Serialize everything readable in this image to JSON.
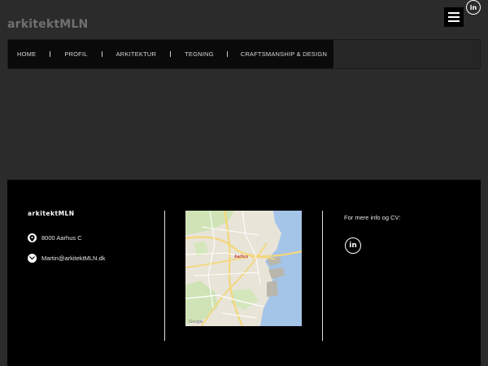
{
  "header": {
    "logo": "arkitektMLN",
    "linkedin_icon": "linkedin-icon",
    "linkedin_glyph": "in",
    "menu_icon": "hamburger-menu-icon"
  },
  "nav": {
    "items": [
      {
        "label": "HOME"
      },
      {
        "label": "PROFIL"
      },
      {
        "label": "ARKITEKTUR"
      },
      {
        "label": "TEGNING"
      },
      {
        "label": "CRAFTSMANSHIP & DESIGN"
      }
    ]
  },
  "footer": {
    "brand": "arkitektMLN",
    "address": "8000 Aarhus C",
    "address_icon": "location-pin-icon",
    "email": "Martin@arkitektMLN.dk",
    "email_icon": "email-icon",
    "more_info": "For mere info og CV:",
    "linkedin_icon": "linkedin-icon",
    "linkedin_glyph": "in",
    "map": {
      "city_label": "Aarhus",
      "attribution": "Google"
    }
  },
  "colors": {
    "page_bg": "#2b2b2b",
    "footer_bg": "#000000",
    "nav_bg": "#0a0a0a",
    "water": "#a4c4e8"
  }
}
